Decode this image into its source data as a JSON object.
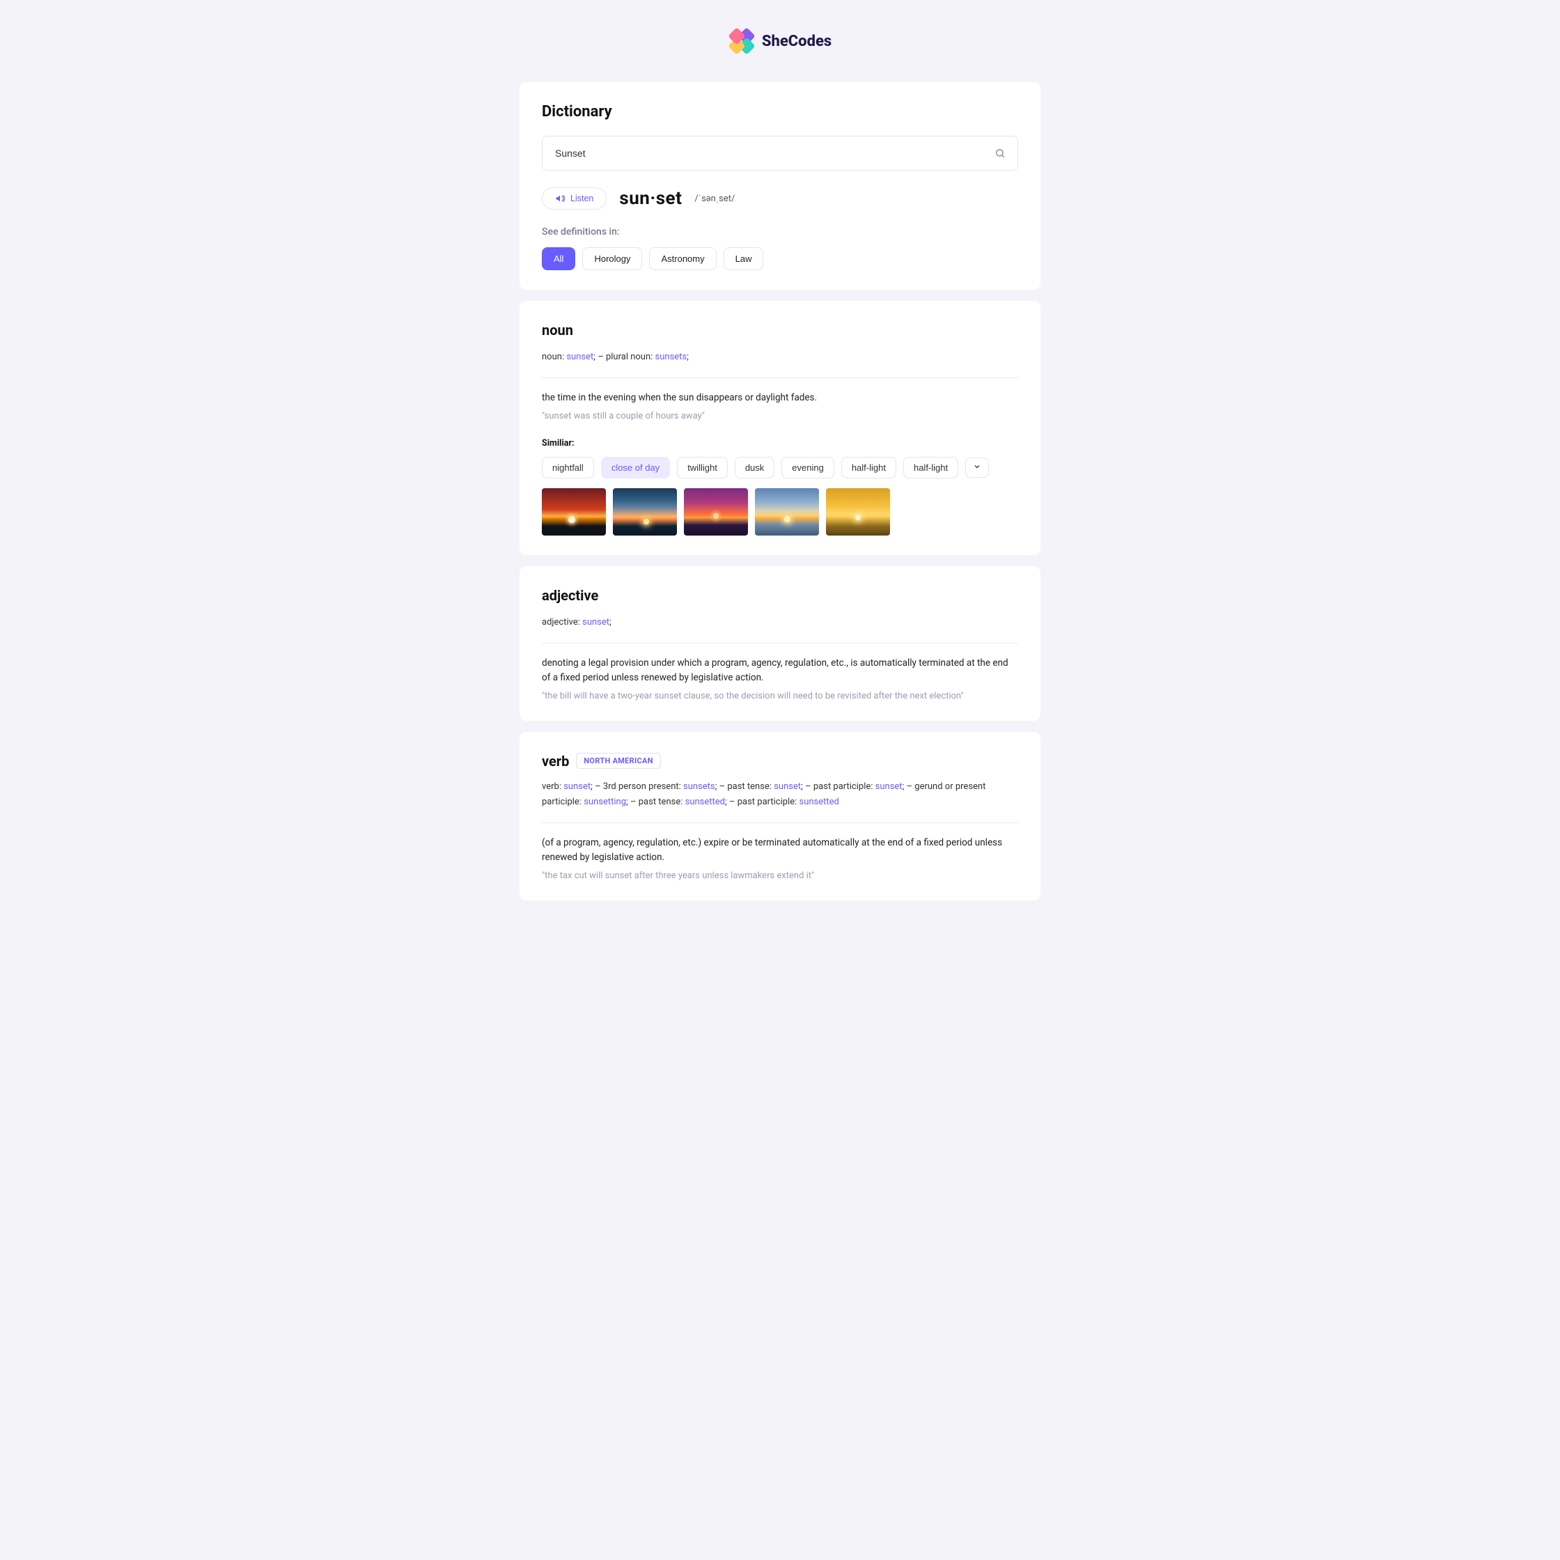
{
  "brand": {
    "name": "SheCodes"
  },
  "header": {
    "title": "Dictionary",
    "search_value": "Sunset",
    "listen_label": "Listen",
    "word_display": "sun·set",
    "phonetic": "/ˈsənˌset/",
    "see_definitions_label": "See definitions in:",
    "filters": {
      "all": "All",
      "horology": "Horology",
      "astronomy": "Astronomy",
      "law": "Law",
      "active": "all"
    }
  },
  "noun": {
    "heading": "noun",
    "forms_prefix_1": "noun: ",
    "forms_val_1": "sunset",
    "forms_sep_1": ";   –   plural noun: ",
    "forms_val_2": "sunsets",
    "forms_tail": ";",
    "definition": "the time in the evening when the sun disappears or daylight fades.",
    "example": "\"sunset was still a couple of hours away\"",
    "similiar_label": "Similiar:",
    "similar": {
      "s1": "nightfall",
      "s2": "close of day",
      "s3": "twillight",
      "s4": "dusk",
      "s5": "evening",
      "s6": "half-light",
      "s7": "half-light"
    }
  },
  "adjective": {
    "heading": "adjective",
    "forms_prefix_1": "adjective: ",
    "forms_val_1": "sunset",
    "forms_tail": ";",
    "definition": "denoting a legal provision under which a program, agency, regulation, etc., is automatically terminated at the end of a fixed period unless renewed by legislative action.",
    "example": "\"the bill will have a two-year sunset clause, so the decision will need to be revisited after the next election\""
  },
  "verb": {
    "heading": "verb",
    "badge": "NORTH AMERICAN",
    "f1_label": "verb: ",
    "f1_val": "sunset",
    "f2_label": ";   –   3rd person present: ",
    "f2_val": "sunsets",
    "f3_label": ";   –   past tense: ",
    "f3_val": "sunset",
    "f4_label": ";   –   past participle: ",
    "f4_val": "sunset",
    "f5_label": ";   –   gerund or present participle: ",
    "f5_val": "sunsetting",
    "f6_label": ";   –   past tense: ",
    "f6_val": "sunsetted",
    "f7_label": ";   –   past participle: ",
    "f7_val": "sunsetted",
    "definition": "(of a program, agency, regulation, etc.) expire or be terminated automatically at the end of a fixed period unless renewed by legislative action.",
    "example": "\"the tax cut will sunset after three years unless lawmakers extend it\""
  }
}
